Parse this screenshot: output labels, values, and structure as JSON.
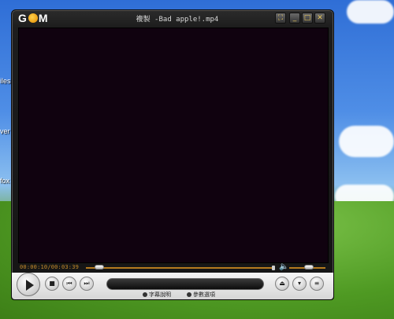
{
  "window": {
    "title": "複製 -Bad apple!.mp4",
    "logo": {
      "g": "G",
      "o": "O",
      "m": "M"
    },
    "buttons": {
      "skin": "⛶",
      "minimize": "_",
      "maximize": "□",
      "close": "✕"
    }
  },
  "playback": {
    "time_text": "00:00:10/00:03:39",
    "position_fraction": 0.046,
    "volume_fraction": 0.55
  },
  "controls": {
    "play_icon": "play-icon",
    "stop_icon": "■",
    "prev_icon": "⏮",
    "next_icon": "⏭",
    "eject_icon": "⏏",
    "down_icon": "▾",
    "menu_icon": "≡"
  },
  "links": {
    "subtitles": "字幕說明",
    "preferences": "參數選項"
  },
  "desktop": {
    "labels": [
      "iles",
      "ver",
      "fox"
    ]
  },
  "colors": {
    "accent": "#c68a2a",
    "video_bg": "#10020f"
  }
}
